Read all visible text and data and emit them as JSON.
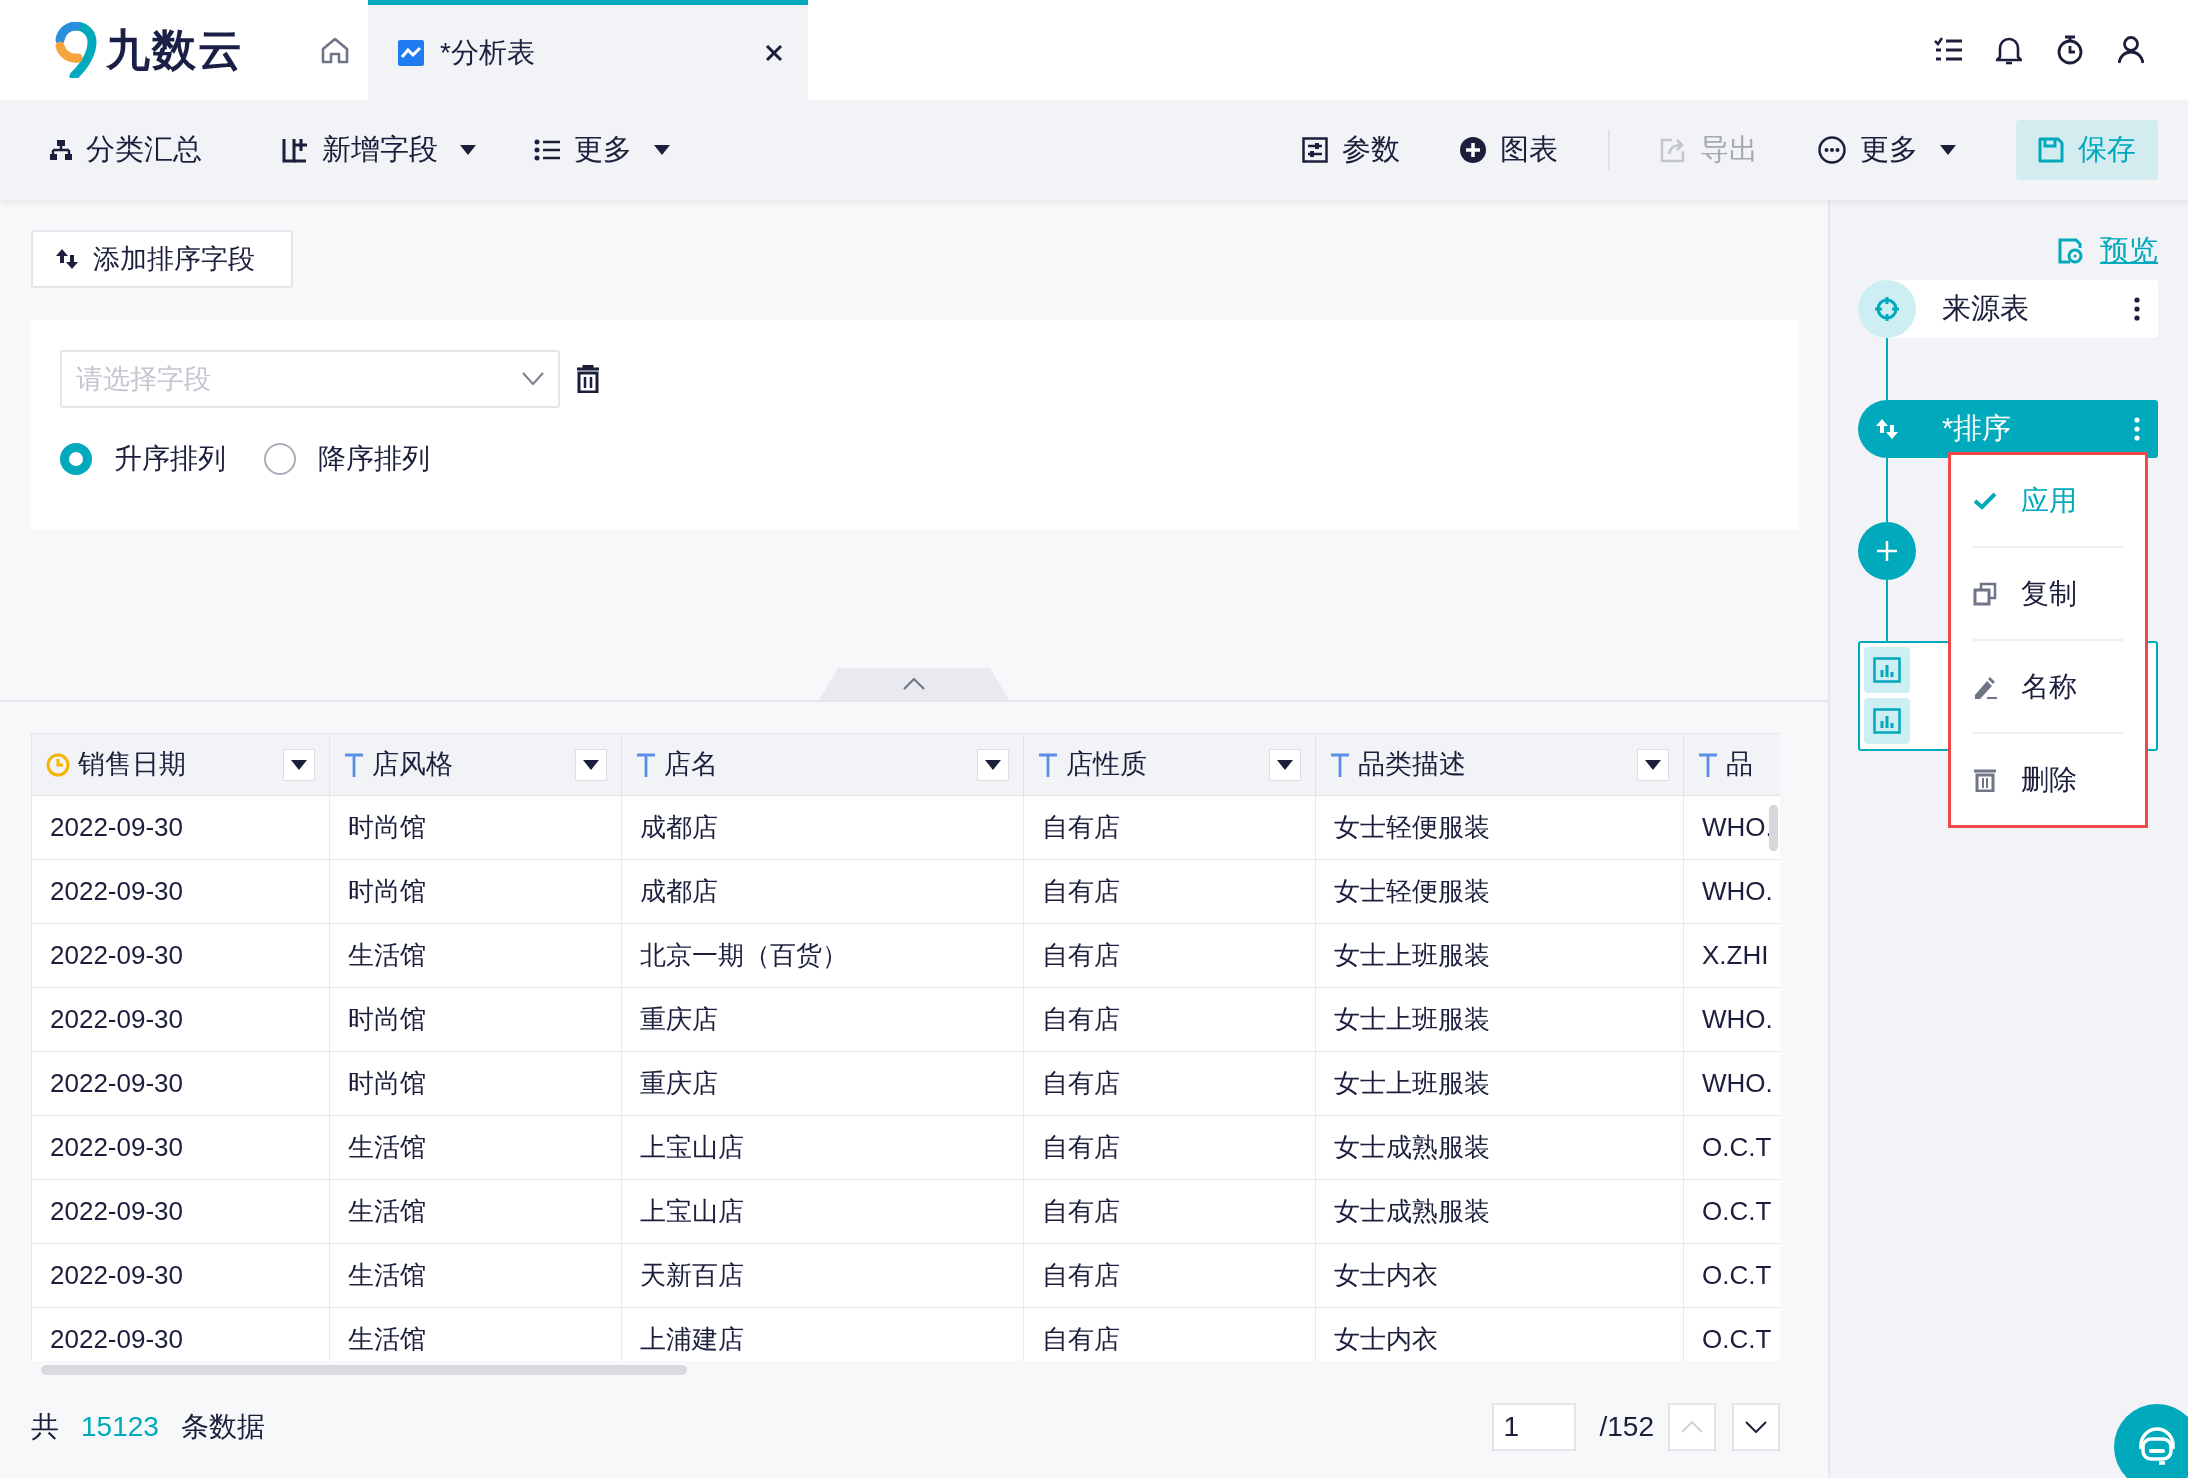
{
  "app": {
    "logo_text": "九数云"
  },
  "tabs": [
    {
      "label": "*分析表",
      "selected": true
    }
  ],
  "toolbar": {
    "left": [
      {
        "label": "分类汇总",
        "kind": "group",
        "dropdown": false
      },
      {
        "label": "新增字段",
        "kind": "add-field",
        "dropdown": true
      },
      {
        "label": "更多",
        "kind": "list",
        "dropdown": true
      }
    ],
    "right": [
      {
        "label": "参数",
        "kind": "params",
        "dropdown": false,
        "disabled": false
      },
      {
        "label": "图表",
        "kind": "chart",
        "dropdown": false,
        "disabled": false
      },
      {
        "label": "导出",
        "kind": "export",
        "dropdown": false,
        "disabled": true
      },
      {
        "label": "更多",
        "kind": "more",
        "dropdown": true,
        "disabled": false
      }
    ],
    "save": "保存"
  },
  "sort_panel": {
    "add_button": "添加排序字段",
    "field_select": {
      "placeholder": "请选择字段"
    },
    "order_options": [
      {
        "label": "升序排列",
        "selected": true
      },
      {
        "label": "降序排列",
        "selected": false
      }
    ]
  },
  "table": {
    "columns": [
      {
        "label": "销售日期",
        "kind": "date"
      },
      {
        "label": "店风格",
        "kind": "text"
      },
      {
        "label": "店名",
        "kind": "text"
      },
      {
        "label": "店性质",
        "kind": "text"
      },
      {
        "label": "品类描述",
        "kind": "text"
      },
      {
        "label": "品",
        "kind": "text"
      }
    ],
    "rows": [
      [
        "2022-09-30",
        "时尚馆",
        "成都店",
        "自有店",
        "女士轻便服装",
        "WHO."
      ],
      [
        "2022-09-30",
        "时尚馆",
        "成都店",
        "自有店",
        "女士轻便服装",
        "WHO."
      ],
      [
        "2022-09-30",
        "生活馆",
        "北京一期（百货）",
        "自有店",
        "女士上班服装",
        "X.ZHI"
      ],
      [
        "2022-09-30",
        "时尚馆",
        "重庆店",
        "自有店",
        "女士上班服装",
        "WHO."
      ],
      [
        "2022-09-30",
        "时尚馆",
        "重庆店",
        "自有店",
        "女士上班服装",
        "WHO."
      ],
      [
        "2022-09-30",
        "生活馆",
        "上宝山店",
        "自有店",
        "女士成熟服装",
        "O.C.T"
      ],
      [
        "2022-09-30",
        "生活馆",
        "上宝山店",
        "自有店",
        "女士成熟服装",
        "O.C.T"
      ],
      [
        "2022-09-30",
        "生活馆",
        "天新百店",
        "自有店",
        "女士内衣",
        "O.C.T"
      ],
      [
        "2022-09-30",
        "生活馆",
        "上浦建店",
        "自有店",
        "女士内衣",
        "O.C.T"
      ]
    ]
  },
  "footer": {
    "prefix": "共",
    "total": "15123",
    "suffix": "条数据",
    "page": "1",
    "page_count": "/152",
    "pager": [
      {
        "kind": "up",
        "disabled": true
      },
      {
        "kind": "down",
        "disabled": false
      }
    ]
  },
  "flow": {
    "preview": "预览",
    "nodes": [
      {
        "kind": "source",
        "label": "来源表",
        "selected": false
      },
      {
        "kind": "sort",
        "label": "*排序",
        "selected": true
      },
      {
        "kind": "add"
      },
      {
        "kind": "output"
      }
    ]
  },
  "context_menu": {
    "items": [
      {
        "label": "应用",
        "kind": "apply",
        "checked": true
      },
      {
        "label": "复制",
        "kind": "copy",
        "checked": false
      },
      {
        "label": "名称",
        "kind": "rename",
        "checked": false
      },
      {
        "label": "删除",
        "kind": "delete",
        "checked": false
      }
    ]
  }
}
